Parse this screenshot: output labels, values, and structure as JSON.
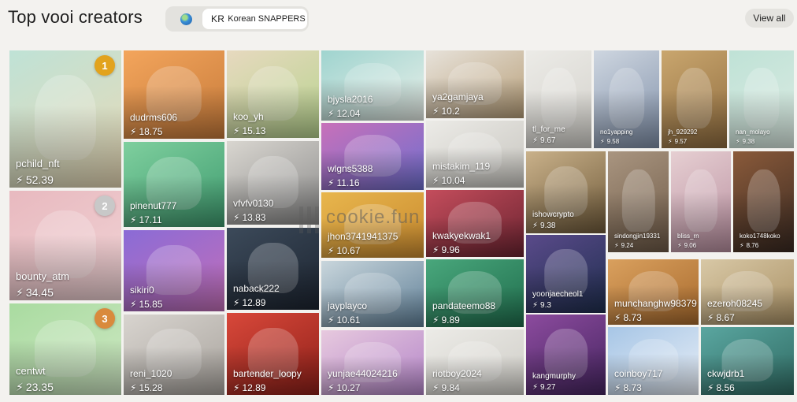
{
  "header": {
    "title": "Top vooi creators",
    "filter_country_code": "KR",
    "filter_name": "Korean SNAPPERS",
    "view_all_label": "View all"
  },
  "watermark": "cookie.fun",
  "colors": {
    "gold": "#e2a31d",
    "silver": "#c8c8c8",
    "bronze": "#d98a3d"
  },
  "creators": [
    {
      "name": "pchild_nft",
      "score": "52.39",
      "rank": "1"
    },
    {
      "name": "bounty_atm",
      "score": "34.45",
      "rank": "2"
    },
    {
      "name": "centwt",
      "score": "23.35",
      "rank": "3"
    },
    {
      "name": "dudrms606",
      "score": "18.75"
    },
    {
      "name": "pinenut777",
      "score": "17.11"
    },
    {
      "name": "sikiri0",
      "score": "15.85"
    },
    {
      "name": "reni_1020",
      "score": "15.28"
    },
    {
      "name": "koo_yh",
      "score": "15.13"
    },
    {
      "name": "vfvfv0130",
      "score": "13.83"
    },
    {
      "name": "naback222",
      "score": "12.89"
    },
    {
      "name": "bartender_loopy",
      "score": "12.89"
    },
    {
      "name": "bjysla2016",
      "score": "12.04"
    },
    {
      "name": "wlgns5388",
      "score": "11.16"
    },
    {
      "name": "jhon3741941375",
      "score": "10.67"
    },
    {
      "name": "jayplayco",
      "score": "10.61"
    },
    {
      "name": "yunjae44024216",
      "score": "10.27"
    },
    {
      "name": "ya2gamjaya",
      "score": "10.2"
    },
    {
      "name": "mistakim_119",
      "score": "10.04"
    },
    {
      "name": "kwakyekwak1",
      "score": "9.96"
    },
    {
      "name": "pandateemo88",
      "score": "9.89"
    },
    {
      "name": "riotboy2024",
      "score": "9.84"
    },
    {
      "name": "tl_for_me",
      "score": "9.67"
    },
    {
      "name": "ishowcrypto",
      "score": "9.38"
    },
    {
      "name": "yoonjaecheol1",
      "score": "9.3"
    },
    {
      "name": "kangmurphy",
      "score": "9.27"
    },
    {
      "name": "no1yapping",
      "score": "9.58"
    },
    {
      "name": "jh_929292",
      "score": "9.57"
    },
    {
      "name": "nan_molayo",
      "score": "9.38"
    },
    {
      "name": "sindongjin19331",
      "score": "9.24"
    },
    {
      "name": "bliss_rn",
      "score": "9.06"
    },
    {
      "name": "koko1748koko",
      "score": "8.76"
    },
    {
      "name": "munchanghw98379",
      "score": "8.73"
    },
    {
      "name": "ezeroh08245",
      "score": "8.67"
    },
    {
      "name": "coinboy717",
      "score": "8.73"
    },
    {
      "name": "ckwjdrb1",
      "score": "8.56"
    }
  ]
}
